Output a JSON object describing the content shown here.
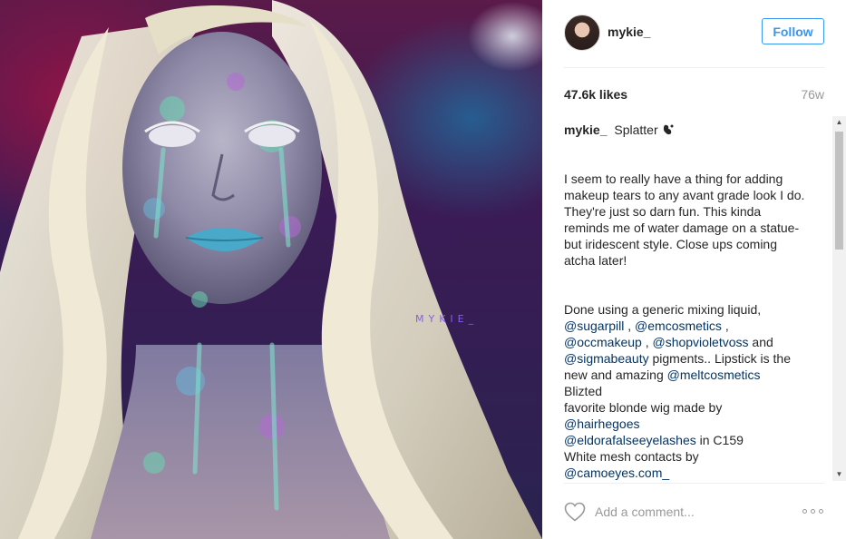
{
  "post": {
    "image_alt": "Portrait with iridescent splatter makeup and platinum wavy hair",
    "watermark": "MYKIE_"
  },
  "header": {
    "username": "mykie_",
    "follow_label": "Follow"
  },
  "stats": {
    "likes": "47.6k likes",
    "age": "76w"
  },
  "caption": {
    "user": "mykie_",
    "title": "Splatter",
    "title_icon": "splatter-emoji",
    "paragraph1": "I seem to really have a thing for adding makeup tears to any avant grade look I do. They're just so darn fun. This kinda reminds me of water damage on a statue- but iridescent style. Close ups coming atcha later!",
    "p2_text1": "Done using a generic mixing liquid,",
    "m1": "@sugarpill",
    "sep1": " , ",
    "m2": "@emcosmetics",
    "sep2": " ,",
    "m3": "@occmakeup",
    "sep3": " , ",
    "m4": "@shopvioletvoss",
    "text_and": " and",
    "m5": "@sigmabeauty",
    "text_pigments": " pigments.. Lipstick is the new and amazing ",
    "m6": "@meltcosmetics",
    "line_blizted": "Blizted",
    "line_wig": "favorite blonde wig made by",
    "m7": "@hairhegoes",
    "m8": "@eldorafalseeyelashes",
    "text_c159": " in C159",
    "line_contacts": "White mesh contacts by",
    "m9": "@camoeyes.com_"
  },
  "comment": {
    "placeholder": "Add a comment..."
  },
  "icons": {
    "like": "heart-outline-icon",
    "more": "more-options-icon",
    "scroll_up": "scroll-up-arrow",
    "scroll_down": "scroll-down-arrow"
  },
  "colors": {
    "follow_blue": "#3897f0",
    "mention": "#003569",
    "muted": "#999999",
    "text": "#262626"
  }
}
